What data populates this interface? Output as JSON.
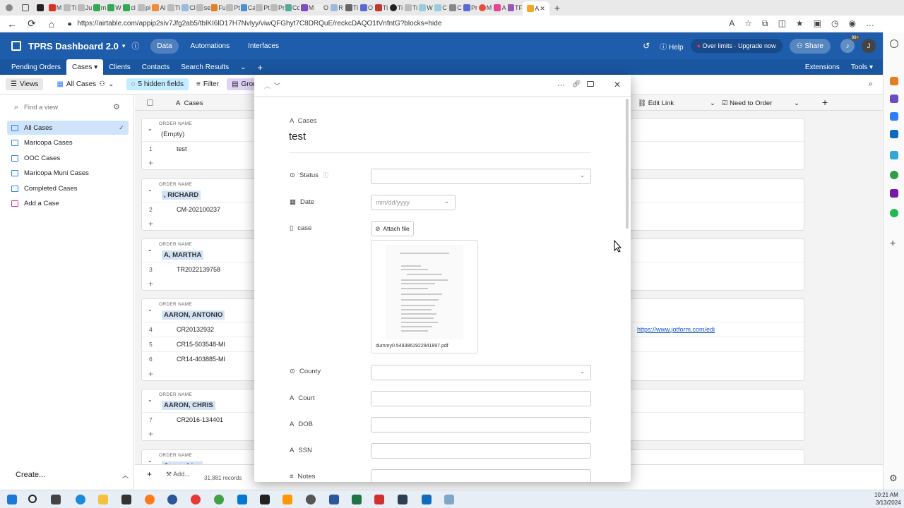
{
  "browser": {
    "url": "https://airtable.com/appip2siv7Jfg2ab5/tblKI6lD17H7Nvlyy/viwQFGhyt7C8DRQuE/reckcDAQO1tVnfntG?blocks=hide",
    "tabs": [
      "M",
      "Ti",
      "Ju",
      "m",
      "W",
      "cl",
      "pi",
      "Al",
      "Ti",
      "Cl",
      "se",
      "Fu",
      "Pt",
      "Ca",
      "Pt",
      "Pr",
      "Cc",
      "M",
      "O",
      "R",
      "Ti",
      "O",
      "Ti",
      "Ti",
      "Ti",
      "W",
      "C",
      "C",
      "Pr",
      "M",
      "A",
      "TF",
      "A"
    ]
  },
  "header": {
    "base_name": "TPRS Dashboard 2.0",
    "nav": [
      "Data",
      "Automations",
      "Interfaces"
    ],
    "help": "Help",
    "over_limits": "Over limits · Upgrade now",
    "share": "Share",
    "notif_count": "99+",
    "avatar": "J"
  },
  "tables": {
    "items": [
      "Pending Orders",
      "Cases",
      "Clients",
      "Contacts",
      "Search Results"
    ],
    "extensions": "Extensions",
    "tools": "Tools"
  },
  "viewbar": {
    "views": "Views",
    "current_view": "All Cases",
    "hidden_fields": "5 hidden fields",
    "filter": "Filter",
    "grouped": "Grouped"
  },
  "sidebar": {
    "find_placeholder": "Find a view",
    "items": [
      "All Cases",
      "Maricopa Cases",
      "OOC Cases",
      "Maricopa Muni Cases",
      "Completed Cases",
      "Add a Case"
    ],
    "create": "Create..."
  },
  "grid": {
    "col_primary": "Cases",
    "col_edit_link": "Edit Link",
    "col_need_to_order": "Need to Order",
    "group_label": "ORDER NAME",
    "groups": [
      {
        "name": "(Empty)",
        "rows": [
          {
            "num": "1",
            "value": "test"
          }
        ]
      },
      {
        "name": ", RICHARD",
        "rows": [
          {
            "num": "2",
            "value": "CM-202100237"
          }
        ]
      },
      {
        "name": "A, MARTHA",
        "rows": [
          {
            "num": "3",
            "value": "TR2022139758"
          }
        ]
      },
      {
        "name": "AARON, ANTONIO",
        "rows": [
          {
            "num": "4",
            "value": "CR20132932"
          },
          {
            "num": "5",
            "value": "CR15-503548-MI"
          },
          {
            "num": "6",
            "value": "CR14-403885-MI"
          }
        ]
      },
      {
        "name": "AARON, CHRIS",
        "rows": [
          {
            "num": "7",
            "value": "CR2016-134401"
          }
        ]
      },
      {
        "name": "Aaron, Lisa",
        "rows": []
      }
    ],
    "link_value": "https://www.jotform.com/edi",
    "add_label": "Add...",
    "record_count": "31,881 records"
  },
  "modal": {
    "table_label": "Cases",
    "title": "test",
    "fields": {
      "status": "Status",
      "date": "Date",
      "date_placeholder": "mm/dd/yyyy",
      "case": "case",
      "attach": "Attach file",
      "filename": "dummy0.5483861922941897.pdf",
      "county": "County",
      "court": "Court",
      "dob": "DOB",
      "ssn": "SSN",
      "notes": "Notes"
    }
  },
  "taskbar": {
    "time": "10:21 AM",
    "date": "3/13/2024"
  }
}
